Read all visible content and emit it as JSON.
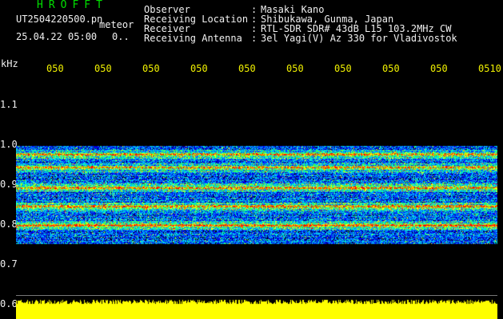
{
  "header": {
    "app_title": "HROFFT",
    "filename": "UT2504220500.pn",
    "mode": "meteor",
    "datetime": "25.04.22 05:00",
    "counter": "0.."
  },
  "info": [
    {
      "label": "Observer",
      "value": "Masaki Kano"
    },
    {
      "label": "Receiving Location",
      "value": "Shibukawa, Gunma, Japan"
    },
    {
      "label": "Receiver",
      "value": "RTL-SDR SDR# 43dB L15 103.2MHz CW"
    },
    {
      "label": "Receiving Antenna",
      "value": "3el Yagi(V) Az 330 for Vladivostok"
    }
  ],
  "axis": {
    "unit": "kHz",
    "time_ticks": [
      "050",
      "050",
      "050",
      "050",
      "050",
      "050",
      "050",
      "050",
      "050",
      "0510"
    ],
    "freq_ticks": [
      "1.1",
      "1.0",
      "0.9",
      "0.8",
      "0.7",
      "0.6"
    ]
  },
  "spectrum": {
    "freq_range_khz": [
      0.6,
      1.2
    ],
    "signal_band_khz": [
      0.76,
      1.02
    ],
    "carrier_lines_khz": [
      1.0,
      0.965,
      0.91,
      0.86,
      0.81
    ],
    "noise_floor_color": "#0000cc",
    "peak_color": "#ff2020",
    "bar_color": "#ffff00"
  }
}
